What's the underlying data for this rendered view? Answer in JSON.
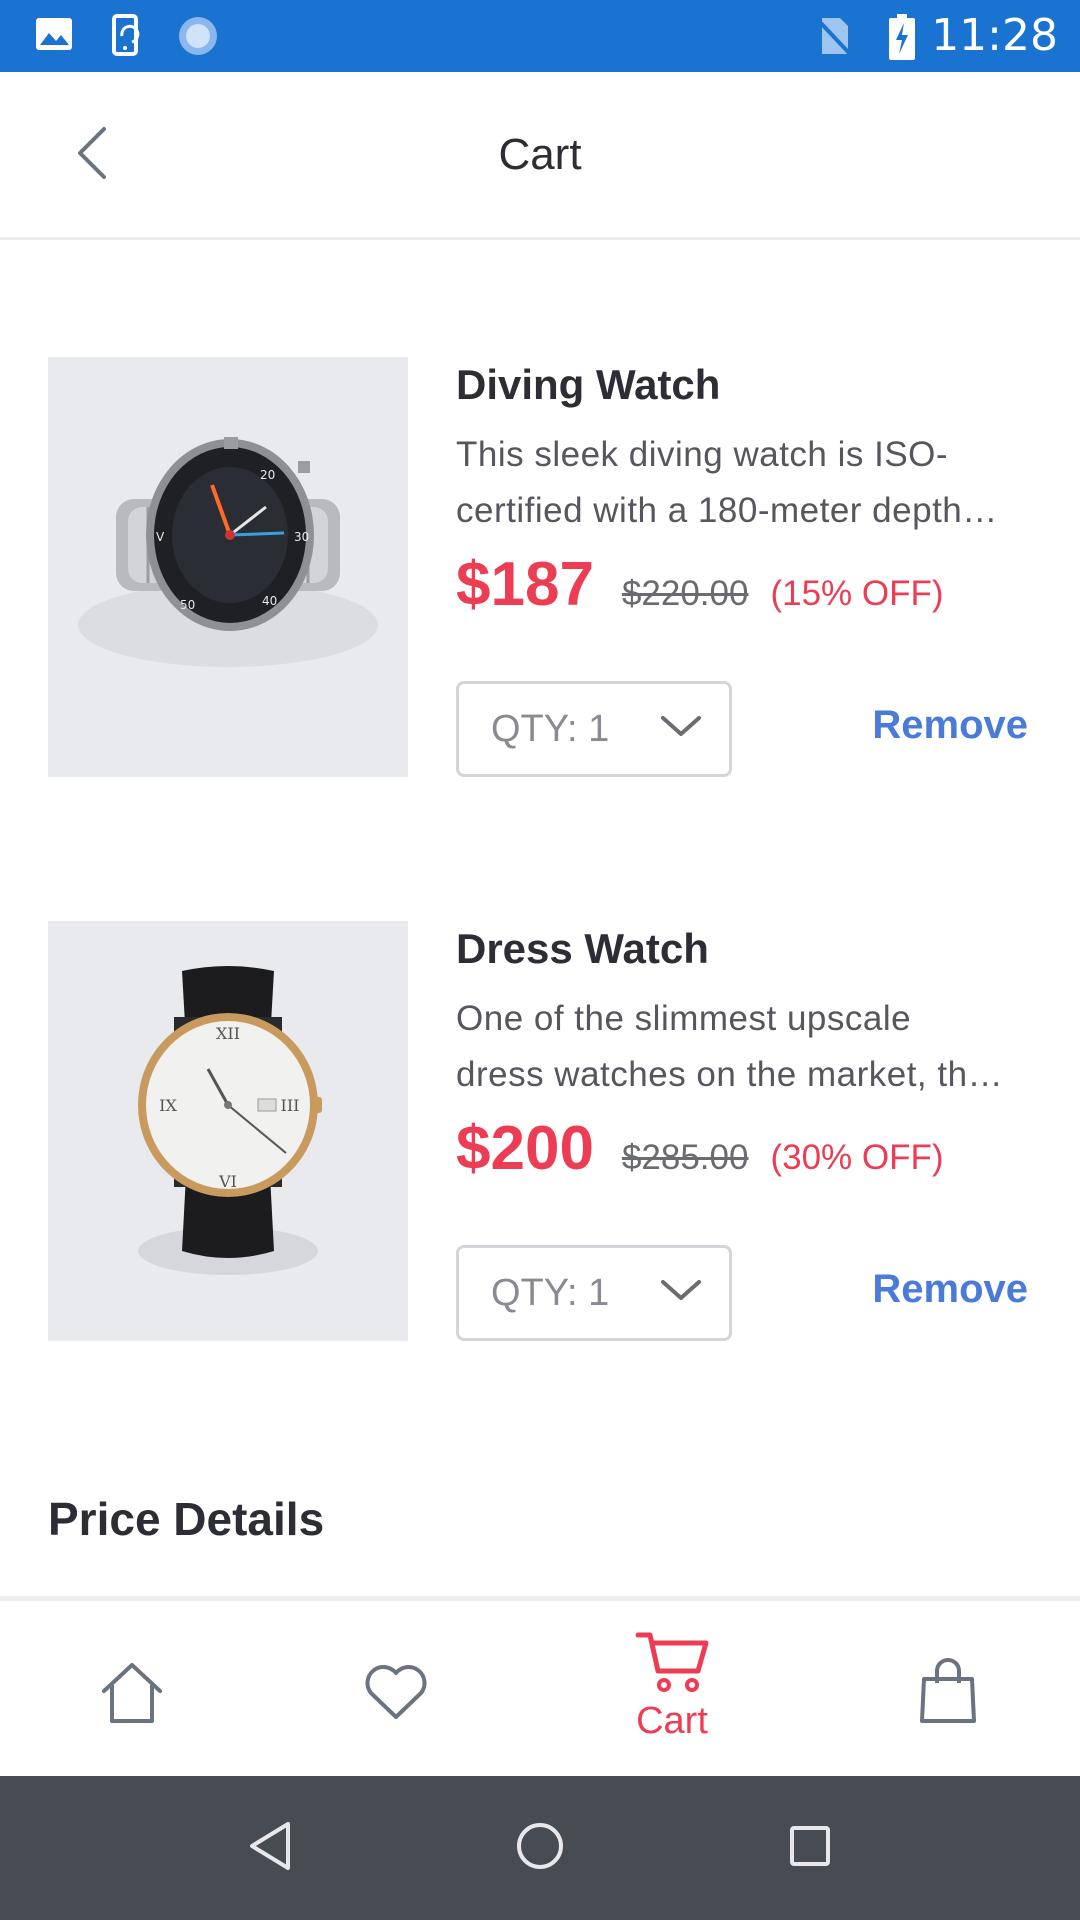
{
  "status_bar": {
    "time": "11:28",
    "left_icons": [
      "gallery-icon",
      "screen-rotate-icon",
      "sync-icon"
    ],
    "right_icons": [
      "no-sim-icon",
      "battery-charging-icon"
    ],
    "background": "#1a73d1"
  },
  "header": {
    "title": "Cart",
    "back_icon": "chevron-left-icon"
  },
  "cart": {
    "items": [
      {
        "name": "Diving Watch",
        "description_line1": "This sleek diving watch is ISO-",
        "description_line2": "certified with a 180-meter depth…",
        "price": "$187",
        "original_price": "$220.00",
        "discount": "(15% OFF)",
        "qty_label": "QTY: 1",
        "remove_label": "Remove",
        "image": "diving-watch-image"
      },
      {
        "name": "Dress Watch",
        "description_line1": "One of the slimmest upscale",
        "description_line2": "dress watches on the market, th…",
        "price": "$200",
        "original_price": "$285.00",
        "discount": "(30% OFF)",
        "qty_label": "QTY: 1",
        "remove_label": "Remove",
        "image": "dress-watch-image"
      }
    ]
  },
  "price_details": {
    "title": "Price Details"
  },
  "bottom_nav": {
    "items": [
      {
        "icon": "home-icon",
        "label": ""
      },
      {
        "icon": "heart-icon",
        "label": ""
      },
      {
        "icon": "cart-icon",
        "label": "Cart",
        "active": true
      },
      {
        "icon": "shopping-bag-icon",
        "label": ""
      }
    ],
    "active_color": "#ec3d54"
  },
  "system_nav": {
    "buttons": [
      "back-triangle-icon",
      "home-circle-icon",
      "recents-square-icon"
    ]
  },
  "colors": {
    "accent": "#ec3d54",
    "link": "#4a7bd8",
    "text": "#2d2d35"
  }
}
